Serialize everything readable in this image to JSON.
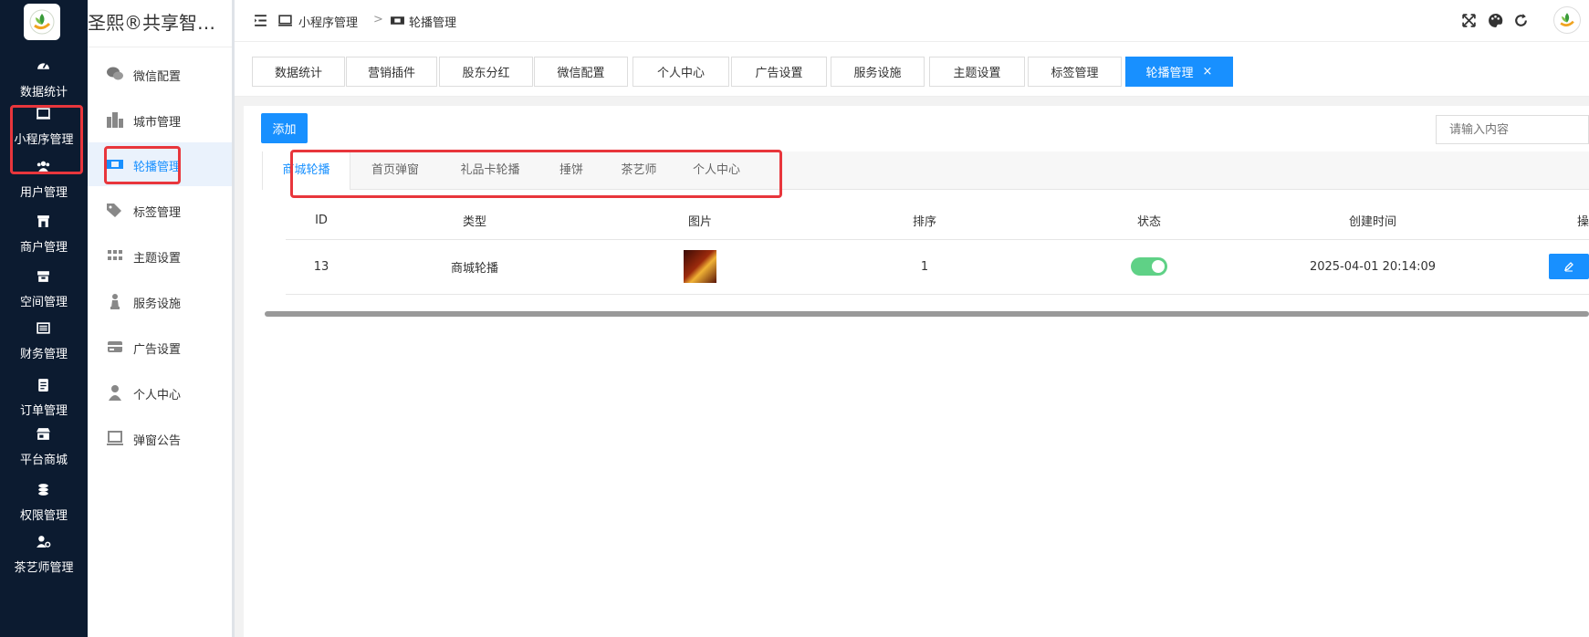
{
  "rail": {
    "items": [
      {
        "label": "数据统计",
        "icon": "dashboard-icon"
      },
      {
        "label": "小程序管理",
        "icon": "monitor-icon"
      },
      {
        "label": "用户管理",
        "icon": "users-icon"
      },
      {
        "label": "商户管理",
        "icon": "store-icon"
      },
      {
        "label": "空间管理",
        "icon": "box-icon"
      },
      {
        "label": "财务管理",
        "icon": "list-icon"
      },
      {
        "label": "订单管理",
        "icon": "clipboard-icon"
      },
      {
        "label": "平台商城",
        "icon": "shop-icon"
      },
      {
        "label": "权限管理",
        "icon": "coins-icon"
      },
      {
        "label": "茶艺师管理",
        "icon": "user-gear-icon"
      }
    ]
  },
  "submenu": {
    "app_title": "圣熙®共享智能…",
    "items": [
      {
        "label": "微信配置",
        "icon": "chat-icon"
      },
      {
        "label": "城市管理",
        "icon": "city-icon"
      },
      {
        "label": "轮播管理",
        "icon": "carousel-icon",
        "active": true
      },
      {
        "label": "标签管理",
        "icon": "tags-icon"
      },
      {
        "label": "主题设置",
        "icon": "grid-icon"
      },
      {
        "label": "服务设施",
        "icon": "chess-icon"
      },
      {
        "label": "广告设置",
        "icon": "card-icon"
      },
      {
        "label": "个人中心",
        "icon": "user-icon"
      },
      {
        "label": "弹窗公告",
        "icon": "laptop-icon"
      }
    ]
  },
  "header": {
    "breadcrumb_parent": "小程序管理",
    "breadcrumb_sep": ">",
    "breadcrumb_current": "轮播管理"
  },
  "tags": [
    {
      "label": "数据统计"
    },
    {
      "label": "营销插件"
    },
    {
      "label": "股东分红"
    },
    {
      "label": "微信配置"
    },
    {
      "label": "个人中心"
    },
    {
      "label": "广告设置"
    },
    {
      "label": "服务设施"
    },
    {
      "label": "主题设置"
    },
    {
      "label": "标签管理"
    },
    {
      "label": "轮播管理",
      "active": true,
      "close": "×"
    }
  ],
  "toolbar": {
    "add_label": "添加",
    "search_placeholder": "请输入内容"
  },
  "subtabs": [
    {
      "label": "商城轮播",
      "active": true
    },
    {
      "label": "首页弹窗"
    },
    {
      "label": "礼品卡轮播"
    },
    {
      "label": "捶饼"
    },
    {
      "label": "茶艺师"
    },
    {
      "label": "个人中心"
    }
  ],
  "table": {
    "columns": [
      "ID",
      "类型",
      "图片",
      "排序",
      "状态",
      "创建时间",
      "操"
    ],
    "rows": [
      {
        "id": "13",
        "type": "商城轮播",
        "sort": "1",
        "status": true,
        "created": "2025-04-01 20:14:09"
      }
    ]
  },
  "colors": {
    "rail_bg": "#0c1b30",
    "accent": "#1890ff",
    "highlight_box": "#e8363c",
    "toggle_on": "#5fd186"
  }
}
